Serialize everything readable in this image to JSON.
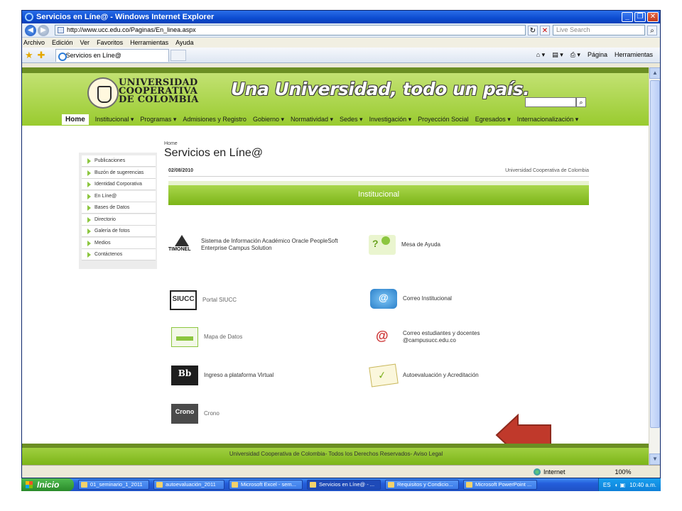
{
  "window": {
    "title": "Servicios en Líne@ - Windows Internet Explorer",
    "url": "http://www.ucc.edu.co/Paginas/En_linea.aspx",
    "search_placeholder": "Live Search",
    "menu": [
      "Archivo",
      "Edición",
      "Ver",
      "Favoritos",
      "Herramientas",
      "Ayuda"
    ],
    "tab_label": "Servicios en Líne@",
    "cmd_page": "Página",
    "cmd_tools": "Herramientas"
  },
  "site": {
    "logo_lines": [
      "UNIVERSIDAD",
      "COOPERATIVA",
      "DE COLOMBIA"
    ],
    "slogan": "Una Universidad, todo un país.",
    "nav": [
      {
        "label": "Home"
      },
      {
        "label": "Institucional ▾"
      },
      {
        "label": "Programas ▾"
      },
      {
        "label": "Admisiones y Registro"
      },
      {
        "label": "Gobierno ▾"
      },
      {
        "label": "Normatividad ▾"
      },
      {
        "label": "Sedes ▾"
      },
      {
        "label": "Investigación ▾"
      },
      {
        "label": "Proyección Social"
      },
      {
        "label": "Egresados ▾"
      },
      {
        "label": "Internacionalización ▾"
      }
    ],
    "sidebar": [
      "Publicaciones",
      "Buzón de sugerencias",
      "Identidad Corporativa",
      "En Líne@",
      "Bases de Datos",
      "Directorio",
      "Galería de fotos",
      "Medios",
      "Contáctenos"
    ],
    "breadcrumb": "Home",
    "page_title": "Servicios en Líne@",
    "date": "02/08/2010",
    "org": "Universidad Cooperativa de Colombia",
    "section": "Institucional",
    "services": {
      "timonel": "Sistema de Información Académico Oracle PeopleSoft\nEnterprise Campus Solution",
      "help": "Mesa de Ayuda",
      "siucc": "Portal SIUCC",
      "mail": "Correo Institucional",
      "data": "Mapa de Datos",
      "mail2": "Correo estudiantes y docentes\n@campusucc.edu.co",
      "virtual": "Ingreso a plataforma Virtual",
      "eval": "Autoevaluación y Acreditación",
      "crono": "Crono"
    },
    "icon_text": {
      "siucc": "SIUCC",
      "bb": "Bb",
      "crono": "Crono"
    },
    "footer": "Universidad Cooperativa de Colombia- Todos los Derechos Reservados- Aviso Legal"
  },
  "status": {
    "zone": "Internet",
    "zoom": "100%"
  },
  "taskbar": {
    "start": "Inicio",
    "buttons": [
      "01_seminario_1_2011",
      "autoevaluación_2011",
      "Microsoft Excel - sem...",
      "Servicios en Líne@ - ...",
      "Requisitos y Condicio...",
      "Microsoft PowerPoint ..."
    ],
    "lang": "ES",
    "clock": "10:40 a.m."
  },
  "colors": {
    "brand_green": "#8cc63f",
    "arrow_red": "#c0392b"
  }
}
